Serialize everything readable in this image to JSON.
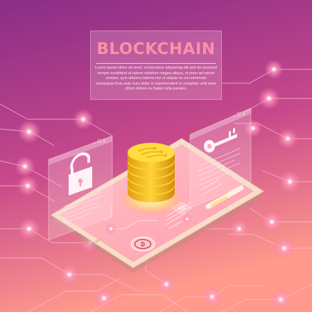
{
  "banner": {
    "title": "BLOCKCHAIN",
    "body": "Lorem ipsum dolor sit amet, consectetur adipiscing elit sed do eiusmod tempor incididunt ut labore etdolore magna aliqua, ut enim ad minim veniam, quis ullamco laboris nisi ut aliquip ex ea commodo consequat.Duis aute irure dolor in reprehenderit in voluptate velit esse cillum dolore eu fugiat nulla pariatur."
  },
  "window_controls": "_ □ x",
  "icons": [
    "lock-icon",
    "key-icon",
    "coin-stack-icon",
    "bitcoin-icon",
    "chip-icon"
  ],
  "colors": {
    "bg_top": "#8a2d87",
    "bg_bottom": "#ff8f8f",
    "accent_pink": "#ff8fa8",
    "coin_gold": "#f4c21e",
    "tablet_frame": "#f6dfc8"
  }
}
